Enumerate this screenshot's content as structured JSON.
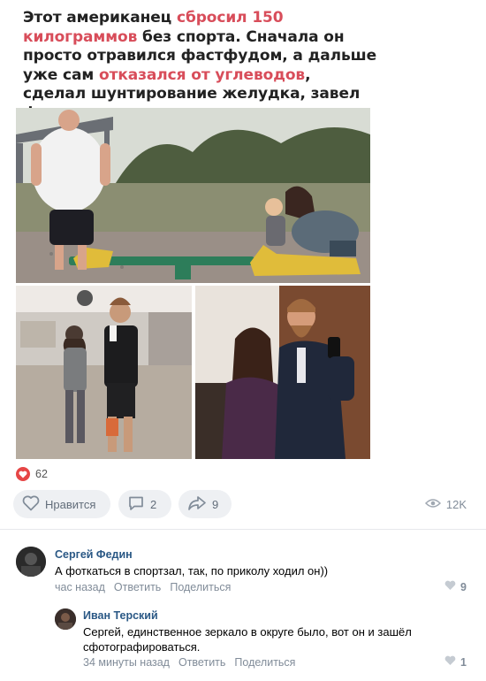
{
  "post": {
    "text_parts": [
      {
        "text": "Этот американец ",
        "hl": false
      },
      {
        "text": "сбросил 150 килограммов",
        "hl": true
      },
      {
        "text": " без спорта. Сначала он просто отравился фастфудом, а дальше уже сам ",
        "hl": false
      },
      {
        "text": "отказался от углеводов",
        "hl": true
      },
      {
        "text": ", сделал шунтирование желудка, завел ферму:",
        "hl": false
      }
    ],
    "highlight_color": "#d84d5a"
  },
  "reactions": {
    "like_count": "62",
    "like_label": "Нравится",
    "comment_count": "2",
    "share_count": "9",
    "views": "12K"
  },
  "comments": [
    {
      "author": "Сергей Федин",
      "text": "А фоткаться в спортзал, так, по приколу ходил он))",
      "time": "час назад",
      "reply_label": "Ответить",
      "share_label": "Поделиться",
      "likes": "9"
    },
    {
      "author": "Иван Терский",
      "text": "Сергей, единственное зеркало в округе было, вот он и зашёл сфотографироваться.",
      "time": "34 минуты назад",
      "reply_label": "Ответить",
      "share_label": "Поделиться",
      "likes": "1"
    }
  ],
  "colors": {
    "link": "#2a5885",
    "muted": "#818c99",
    "button_bg": "#eef0f3",
    "like_red": "#e64646"
  }
}
